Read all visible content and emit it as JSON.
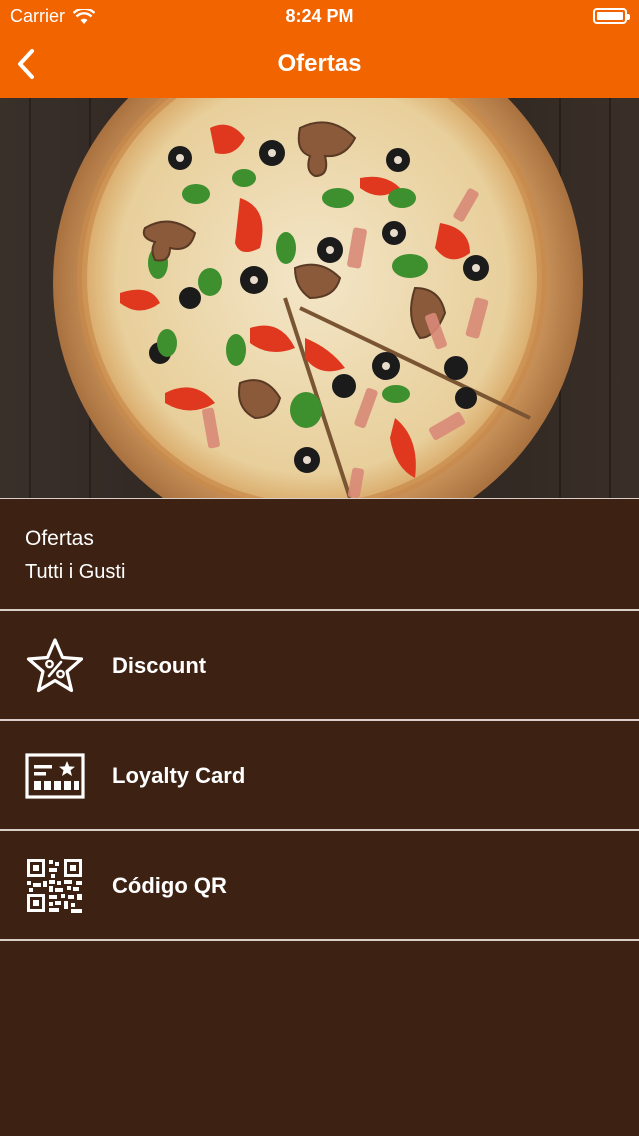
{
  "status_bar": {
    "carrier": "Carrier",
    "time": "8:24 PM"
  },
  "nav": {
    "title": "Ofertas",
    "back_icon": "chevron-left-icon"
  },
  "header": {
    "title": "Ofertas",
    "subtitle": "Tutti i Gusti"
  },
  "menu": {
    "items": [
      {
        "label": "Discount",
        "icon": "discount-star-icon"
      },
      {
        "label": "Loyalty Card",
        "icon": "loyalty-card-icon"
      },
      {
        "label": "Código QR",
        "icon": "qr-code-icon"
      }
    ]
  },
  "colors": {
    "nav_orange": "#f26400",
    "background_brown": "#3d2213",
    "divider": "#d9cfc8"
  }
}
